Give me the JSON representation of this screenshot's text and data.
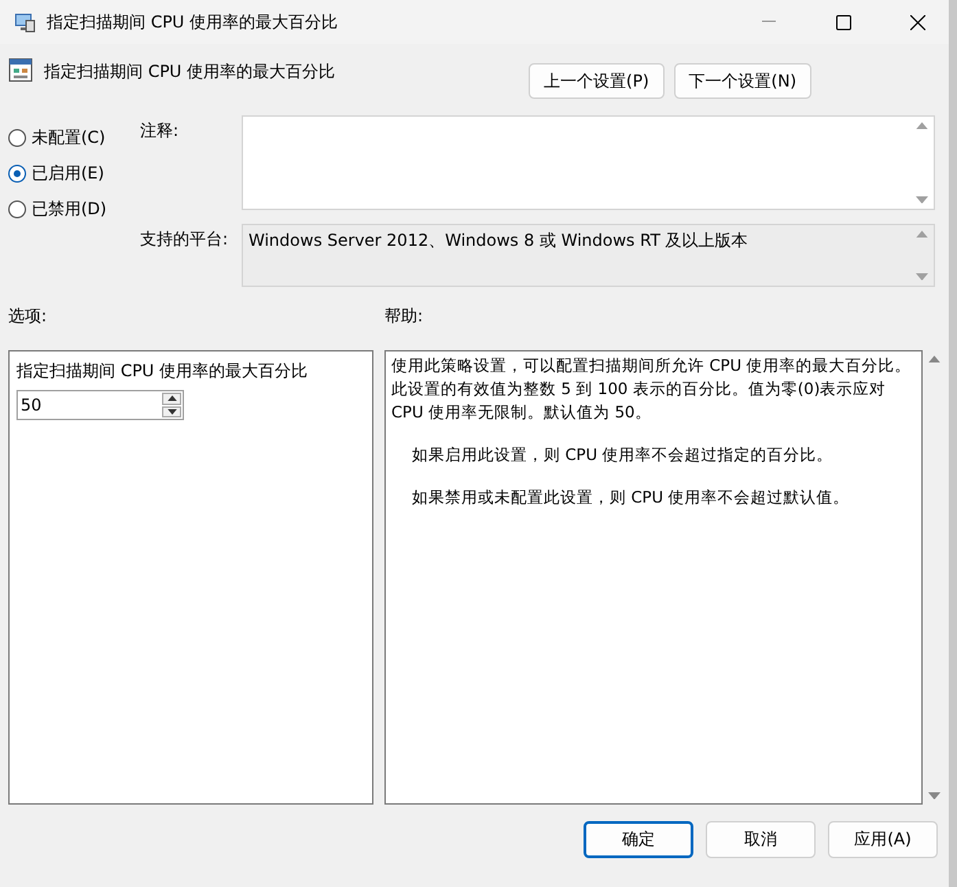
{
  "window": {
    "title": "指定扫描期间 CPU 使用率的最大百分比"
  },
  "header": {
    "title": "指定扫描期间 CPU 使用率的最大百分比",
    "nav_buttons": [
      "上一个设置(P)",
      "下一个设置(N)"
    ]
  },
  "state_options": [
    {
      "label": "未配置(C)",
      "selected": false
    },
    {
      "label": "已启用(E)",
      "selected": true
    },
    {
      "label": "已禁用(D)",
      "selected": false
    }
  ],
  "comment": {
    "label": "注释:"
  },
  "platform": {
    "label": "支持的平台:",
    "value": "Windows Server 2012、Windows 8 或 Windows RT 及以上版本"
  },
  "options": {
    "label": "选项:",
    "setting_label": "指定扫描期间 CPU 使用率的最大百分比",
    "value": "50"
  },
  "help": {
    "label": "帮助:",
    "paragraphs": [
      {
        "text": "使用此策略设置，可以配置扫描期间所允许 CPU 使用率的最大百分比。此设置的有效值为整数 5 到 100 表示的百分比。值为零(0)表示应对 CPU 使用率无限制。默认值为 50。",
        "indent": false
      },
      {
        "text": "如果启用此设置，则 CPU 使用率不会超过指定的百分比。",
        "indent": true
      },
      {
        "text": "如果禁用或未配置此设置，则 CPU 使用率不会超过默认值。",
        "indent": true
      }
    ]
  },
  "buttons": [
    {
      "label": "确定",
      "selected": true
    },
    {
      "label": "取消",
      "selected": false
    },
    {
      "label": "应用(A)",
      "selected": false
    }
  ]
}
